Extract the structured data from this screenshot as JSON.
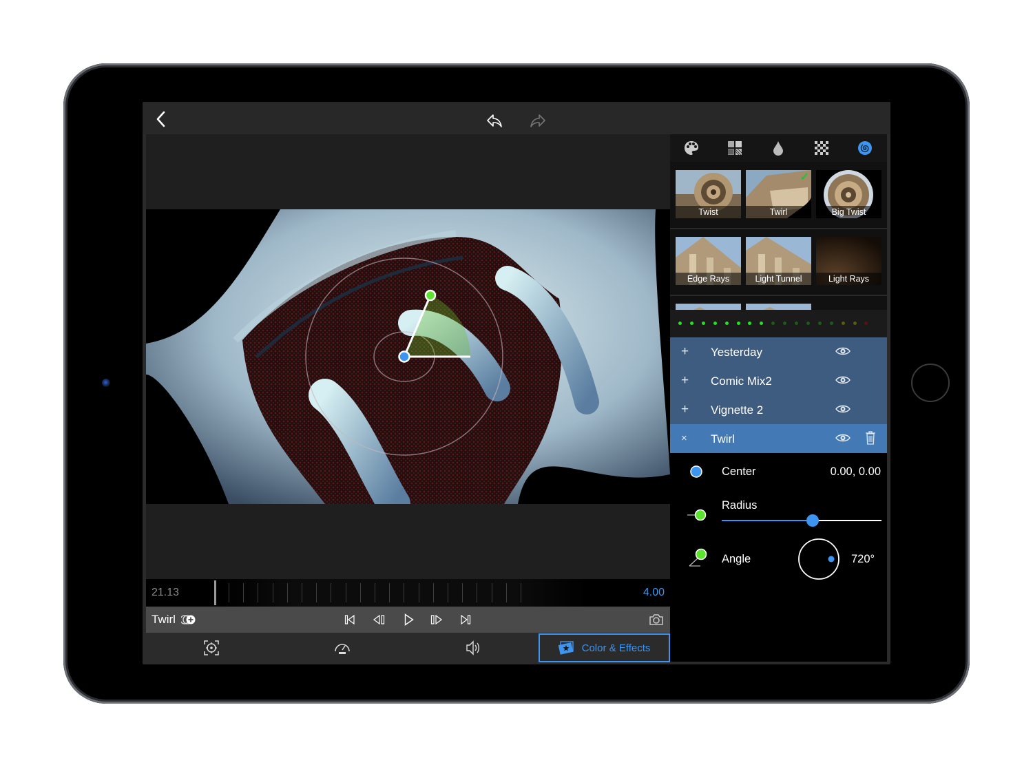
{
  "toolbar": {
    "back_icon": "chevron-left-icon",
    "undo_icon": "undo-icon",
    "redo_icon": "redo-icon"
  },
  "effect_categories": [
    {
      "name": "palette",
      "icon": "palette-icon",
      "active": false
    },
    {
      "name": "patterns",
      "icon": "pattern-grid-icon",
      "active": false
    },
    {
      "name": "drop",
      "icon": "drop-icon",
      "active": false
    },
    {
      "name": "pixelate",
      "icon": "checker-icon",
      "active": false
    },
    {
      "name": "distortion",
      "icon": "spiral-icon",
      "active": true
    }
  ],
  "effect_presets": [
    [
      {
        "label": "Twist",
        "selected": false
      },
      {
        "label": "Twirl",
        "selected": true
      },
      {
        "label": "Big Twist",
        "selected": false
      }
    ],
    [
      {
        "label": "Edge Rays",
        "selected": false
      },
      {
        "label": "Light Tunnel",
        "selected": false
      },
      {
        "label": "Light Rays",
        "selected": false
      }
    ],
    [
      {
        "label": "",
        "selected": false
      },
      {
        "label": "",
        "selected": false
      },
      {
        "label": "",
        "selected": false
      }
    ]
  ],
  "level_meter": {
    "dots": [
      "bright",
      "bright",
      "bright",
      "bright",
      "bright",
      "bright",
      "bright",
      "bright",
      "dim",
      "dim",
      "dim",
      "dim",
      "dim",
      "dim",
      "olive",
      "olive",
      "red"
    ]
  },
  "layers": [
    {
      "sign": "+",
      "name": "Yesterday",
      "selected": false
    },
    {
      "sign": "+",
      "name": "Comic Mix2",
      "selected": false
    },
    {
      "sign": "+",
      "name": "Vignette 2",
      "selected": false
    },
    {
      "sign": "×",
      "name": "Twirl",
      "selected": true
    }
  ],
  "params": {
    "center": {
      "label": "Center",
      "value": "0.00, 0.00"
    },
    "radius": {
      "label": "Radius",
      "fraction": 0.57
    },
    "angle": {
      "label": "Angle",
      "value": "720°"
    }
  },
  "timeline": {
    "current_time": "21.13",
    "duration": "4.00"
  },
  "transport": {
    "clip_name": "Twirl"
  },
  "bottom_tabs": [
    {
      "name": "crop",
      "icon": "crop-target-icon",
      "label": ""
    },
    {
      "name": "speed",
      "icon": "speedometer-icon",
      "label": ""
    },
    {
      "name": "audio",
      "icon": "speaker-icon",
      "label": ""
    },
    {
      "name": "color-effects",
      "icon": "color-effects-icon",
      "label": "Color & Effects",
      "active": true
    }
  ],
  "colors": {
    "accent": "#3d95f0",
    "handle_green": "#5be32e",
    "layer_bg": "#3e5c80",
    "layer_selected": "#4379b4"
  }
}
